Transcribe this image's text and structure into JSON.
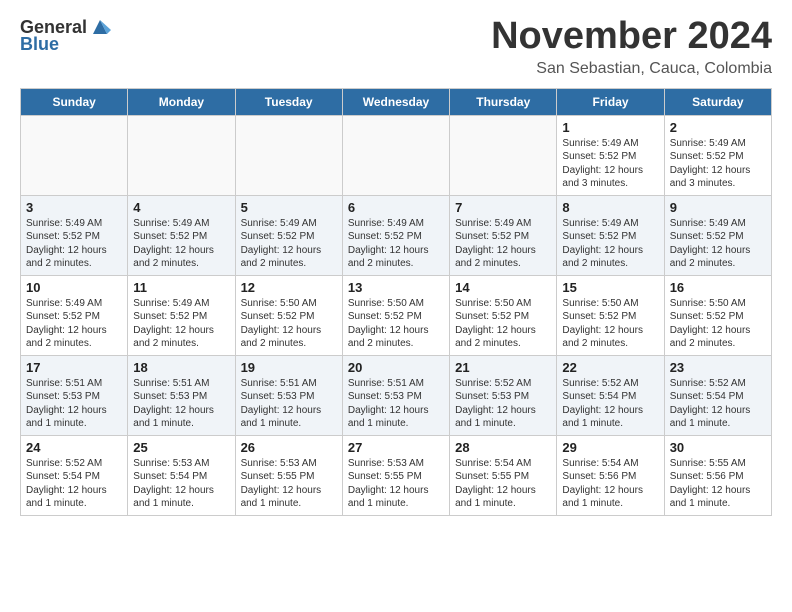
{
  "header": {
    "logo_general": "General",
    "logo_blue": "Blue",
    "month_title": "November 2024",
    "location": "San Sebastian, Cauca, Colombia"
  },
  "calendar": {
    "days_of_week": [
      "Sunday",
      "Monday",
      "Tuesday",
      "Wednesday",
      "Thursday",
      "Friday",
      "Saturday"
    ],
    "weeks": [
      {
        "alt": false,
        "days": [
          {
            "num": "",
            "info": "",
            "empty": true
          },
          {
            "num": "",
            "info": "",
            "empty": true
          },
          {
            "num": "",
            "info": "",
            "empty": true
          },
          {
            "num": "",
            "info": "",
            "empty": true
          },
          {
            "num": "",
            "info": "",
            "empty": true
          },
          {
            "num": "1",
            "info": "Sunrise: 5:49 AM\nSunset: 5:52 PM\nDaylight: 12 hours\nand 3 minutes.",
            "empty": false
          },
          {
            "num": "2",
            "info": "Sunrise: 5:49 AM\nSunset: 5:52 PM\nDaylight: 12 hours\nand 3 minutes.",
            "empty": false
          }
        ]
      },
      {
        "alt": true,
        "days": [
          {
            "num": "3",
            "info": "Sunrise: 5:49 AM\nSunset: 5:52 PM\nDaylight: 12 hours\nand 2 minutes.",
            "empty": false
          },
          {
            "num": "4",
            "info": "Sunrise: 5:49 AM\nSunset: 5:52 PM\nDaylight: 12 hours\nand 2 minutes.",
            "empty": false
          },
          {
            "num": "5",
            "info": "Sunrise: 5:49 AM\nSunset: 5:52 PM\nDaylight: 12 hours\nand 2 minutes.",
            "empty": false
          },
          {
            "num": "6",
            "info": "Sunrise: 5:49 AM\nSunset: 5:52 PM\nDaylight: 12 hours\nand 2 minutes.",
            "empty": false
          },
          {
            "num": "7",
            "info": "Sunrise: 5:49 AM\nSunset: 5:52 PM\nDaylight: 12 hours\nand 2 minutes.",
            "empty": false
          },
          {
            "num": "8",
            "info": "Sunrise: 5:49 AM\nSunset: 5:52 PM\nDaylight: 12 hours\nand 2 minutes.",
            "empty": false
          },
          {
            "num": "9",
            "info": "Sunrise: 5:49 AM\nSunset: 5:52 PM\nDaylight: 12 hours\nand 2 minutes.",
            "empty": false
          }
        ]
      },
      {
        "alt": false,
        "days": [
          {
            "num": "10",
            "info": "Sunrise: 5:49 AM\nSunset: 5:52 PM\nDaylight: 12 hours\nand 2 minutes.",
            "empty": false
          },
          {
            "num": "11",
            "info": "Sunrise: 5:49 AM\nSunset: 5:52 PM\nDaylight: 12 hours\nand 2 minutes.",
            "empty": false
          },
          {
            "num": "12",
            "info": "Sunrise: 5:50 AM\nSunset: 5:52 PM\nDaylight: 12 hours\nand 2 minutes.",
            "empty": false
          },
          {
            "num": "13",
            "info": "Sunrise: 5:50 AM\nSunset: 5:52 PM\nDaylight: 12 hours\nand 2 minutes.",
            "empty": false
          },
          {
            "num": "14",
            "info": "Sunrise: 5:50 AM\nSunset: 5:52 PM\nDaylight: 12 hours\nand 2 minutes.",
            "empty": false
          },
          {
            "num": "15",
            "info": "Sunrise: 5:50 AM\nSunset: 5:52 PM\nDaylight: 12 hours\nand 2 minutes.",
            "empty": false
          },
          {
            "num": "16",
            "info": "Sunrise: 5:50 AM\nSunset: 5:52 PM\nDaylight: 12 hours\nand 2 minutes.",
            "empty": false
          }
        ]
      },
      {
        "alt": true,
        "days": [
          {
            "num": "17",
            "info": "Sunrise: 5:51 AM\nSunset: 5:53 PM\nDaylight: 12 hours\nand 1 minute.",
            "empty": false
          },
          {
            "num": "18",
            "info": "Sunrise: 5:51 AM\nSunset: 5:53 PM\nDaylight: 12 hours\nand 1 minute.",
            "empty": false
          },
          {
            "num": "19",
            "info": "Sunrise: 5:51 AM\nSunset: 5:53 PM\nDaylight: 12 hours\nand 1 minute.",
            "empty": false
          },
          {
            "num": "20",
            "info": "Sunrise: 5:51 AM\nSunset: 5:53 PM\nDaylight: 12 hours\nand 1 minute.",
            "empty": false
          },
          {
            "num": "21",
            "info": "Sunrise: 5:52 AM\nSunset: 5:53 PM\nDaylight: 12 hours\nand 1 minute.",
            "empty": false
          },
          {
            "num": "22",
            "info": "Sunrise: 5:52 AM\nSunset: 5:54 PM\nDaylight: 12 hours\nand 1 minute.",
            "empty": false
          },
          {
            "num": "23",
            "info": "Sunrise: 5:52 AM\nSunset: 5:54 PM\nDaylight: 12 hours\nand 1 minute.",
            "empty": false
          }
        ]
      },
      {
        "alt": false,
        "days": [
          {
            "num": "24",
            "info": "Sunrise: 5:52 AM\nSunset: 5:54 PM\nDaylight: 12 hours\nand 1 minute.",
            "empty": false
          },
          {
            "num": "25",
            "info": "Sunrise: 5:53 AM\nSunset: 5:54 PM\nDaylight: 12 hours\nand 1 minute.",
            "empty": false
          },
          {
            "num": "26",
            "info": "Sunrise: 5:53 AM\nSunset: 5:55 PM\nDaylight: 12 hours\nand 1 minute.",
            "empty": false
          },
          {
            "num": "27",
            "info": "Sunrise: 5:53 AM\nSunset: 5:55 PM\nDaylight: 12 hours\nand 1 minute.",
            "empty": false
          },
          {
            "num": "28",
            "info": "Sunrise: 5:54 AM\nSunset: 5:55 PM\nDaylight: 12 hours\nand 1 minute.",
            "empty": false
          },
          {
            "num": "29",
            "info": "Sunrise: 5:54 AM\nSunset: 5:56 PM\nDaylight: 12 hours\nand 1 minute.",
            "empty": false
          },
          {
            "num": "30",
            "info": "Sunrise: 5:55 AM\nSunset: 5:56 PM\nDaylight: 12 hours\nand 1 minute.",
            "empty": false
          }
        ]
      }
    ]
  }
}
